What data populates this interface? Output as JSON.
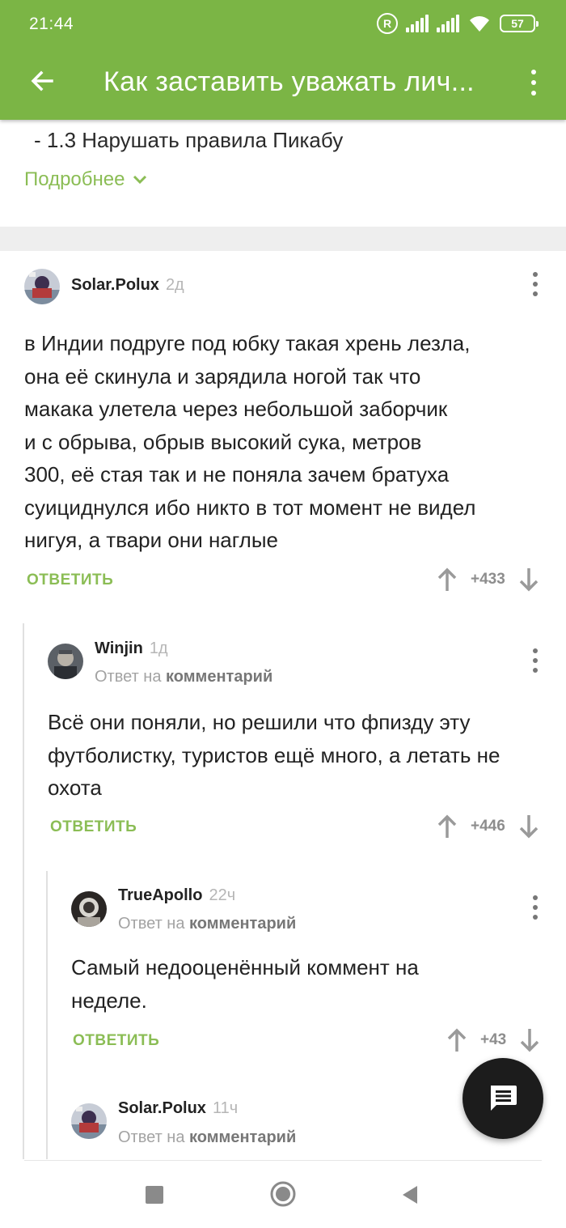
{
  "status_bar": {
    "time": "21:44",
    "battery": "57",
    "registered_mark": "R"
  },
  "app_bar": {
    "title": "Как заставить уважать лич...",
    "back_icon": "arrow-left-icon",
    "menu_icon": "more-vertical-icon"
  },
  "post": {
    "rule_line": "- 1.3 Нарушать правила Пикабу",
    "more_label": "Подробнее"
  },
  "comments": [
    {
      "author": "Solar.Polux",
      "age": "2д",
      "reply_to_prefix": "",
      "reply_to_target": "",
      "lines": [
        "в Индии подруге под юбку такая хрень лезла,",
        "она её скинула и зарядила ногой так что",
        "макака улетела через небольшой заборчик",
        "и с обрыва, обрыв высокий сука, метров",
        "300, её стая так и не поняла зачем братуха",
        "суициднулся ибо никто в тот момент не видел",
        "нигуя, а твари они наглые"
      ],
      "reply_label": "ОТВЕТИТЬ",
      "rating": "+433"
    },
    {
      "author": "Winjin",
      "age": "1д",
      "reply_to_prefix": "Ответ на",
      "reply_to_target": "комментарий",
      "lines": [
        "Всё они поняли, но решили что фпизду эту",
        "футболистку, туристов ещё много, а летать не",
        "охота"
      ],
      "reply_label": "ОТВЕТИТЬ",
      "rating": "+446"
    },
    {
      "author": "TrueApollo",
      "age": "22ч",
      "reply_to_prefix": "Ответ на",
      "reply_to_target": "комментарий",
      "lines": [
        "Самый недооценённый коммент на",
        "неделе."
      ],
      "reply_label": "ОТВЕТИТЬ",
      "rating": "+43"
    },
    {
      "author": "Solar.Polux",
      "age": "11ч",
      "reply_to_prefix": "Ответ на",
      "reply_to_target": "комментарий"
    }
  ],
  "fab": {
    "icon": "chat-icon"
  },
  "colors": {
    "brand_green": "#7bb545",
    "link_green": "#8bbd55",
    "text": "#222222",
    "muted": "#a3a3a3"
  }
}
